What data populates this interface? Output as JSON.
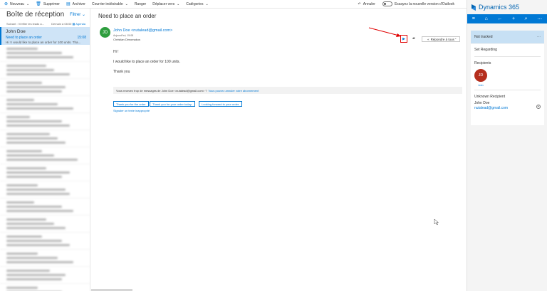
{
  "toolbar": {
    "new_label": "Nouveau",
    "delete_label": "Supprimer",
    "archive_label": "Archiver",
    "junk_label": "Courrier indésirable",
    "sweep_label": "Ranger",
    "move_label": "Déplacer vers",
    "categories_label": "Catégories",
    "undo_label": "Annuler",
    "try_label": "Essayez la nouvelle version d'Outlook"
  },
  "mail_list": {
    "title": "Boîte de réception",
    "filter_label": "Filtrer",
    "sub_left": "Suivant : Vérifier les leads a...",
    "sub_right": "Demain à 08:00",
    "agenda_label": "Agenda",
    "selected": {
      "from": "John Doe",
      "subject": "Need to place an order",
      "time": "15:08",
      "preview": "Hi ! I would like to place an order for 100 units. Tha..."
    }
  },
  "message": {
    "subject": "Need to place an order",
    "avatar_initials": "JD",
    "sender": "John Doe <nutalead@gmail.com>",
    "date": "Aujourd'hui, 15:08",
    "to": "Christian Dimomakos",
    "greeting": "Hi !",
    "line1": "I would like to place an order for 100 units.",
    "line2": "Thank you",
    "notice_text": "Vous recevez trop de messages de John Doe <nutalead@gmail.com> ?",
    "notice_link": "Vous pouvez annuler votre abonnement",
    "quick_replies": [
      "Thank you for the order",
      "Thank you for your order today.",
      "Looking forward to your order."
    ],
    "unsubscribe": "Signaler un texte inapproprié",
    "reply_all_label": "Répondre à tous"
  },
  "dynamics": {
    "title": "Dynamics 365",
    "status": "Not tracked",
    "set_regarding": "Set Regarding",
    "recipients_title": "Recipients",
    "recipient_initials": "JD",
    "recipient_name": "John",
    "unknown_title": "Unknown Recipient",
    "unknown_name": "John Doe",
    "unknown_email": "nutalead@gmail.com"
  },
  "colors": {
    "accent": "#0078d4",
    "selected_bg": "#cfe4f7",
    "avatar_green": "#2e9e3e",
    "avatar_red": "#b52e1d",
    "highlight_red": "#e00000"
  }
}
